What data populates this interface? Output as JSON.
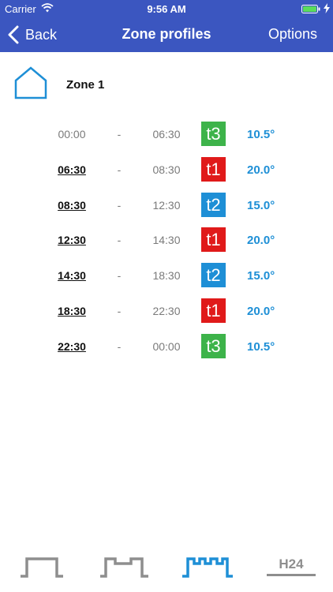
{
  "status_bar": {
    "carrier": "Carrier",
    "time": "9:56 AM"
  },
  "nav": {
    "back_label": "Back",
    "title": "Zone profiles",
    "options_label": "Options"
  },
  "zone": {
    "name": "Zone 1",
    "icon": "home-outline-icon"
  },
  "colors": {
    "header": "#3b56c0",
    "t1": "#e01a1a",
    "t2": "#1e8fd6",
    "t3": "#3db34a",
    "temp_text": "#1e8fd6",
    "active_tab": "#1e8fd6",
    "inactive_tab": "#8e8e8e"
  },
  "schedule": [
    {
      "start": "00:00",
      "dash": "-",
      "end": "06:30",
      "level": "t3",
      "temp": "10.5°"
    },
    {
      "start": "06:30",
      "dash": "-",
      "end": "08:30",
      "level": "t1",
      "temp": "20.0°"
    },
    {
      "start": "08:30",
      "dash": "-",
      "end": "12:30",
      "level": "t2",
      "temp": "15.0°"
    },
    {
      "start": "12:30",
      "dash": "-",
      "end": "14:30",
      "level": "t1",
      "temp": "20.0°"
    },
    {
      "start": "14:30",
      "dash": "-",
      "end": "18:30",
      "level": "t2",
      "temp": "15.0°"
    },
    {
      "start": "18:30",
      "dash": "-",
      "end": "22:30",
      "level": "t1",
      "temp": "20.0°"
    },
    {
      "start": "22:30",
      "dash": "-",
      "end": "00:00",
      "level": "t3",
      "temp": "10.5°"
    }
  ],
  "tabs": [
    {
      "name": "single-step-profile-icon",
      "active": false
    },
    {
      "name": "two-step-profile-icon",
      "active": false
    },
    {
      "name": "multi-step-profile-icon",
      "active": true
    },
    {
      "name": "h24-profile-icon",
      "label": "H24",
      "active": false
    }
  ]
}
